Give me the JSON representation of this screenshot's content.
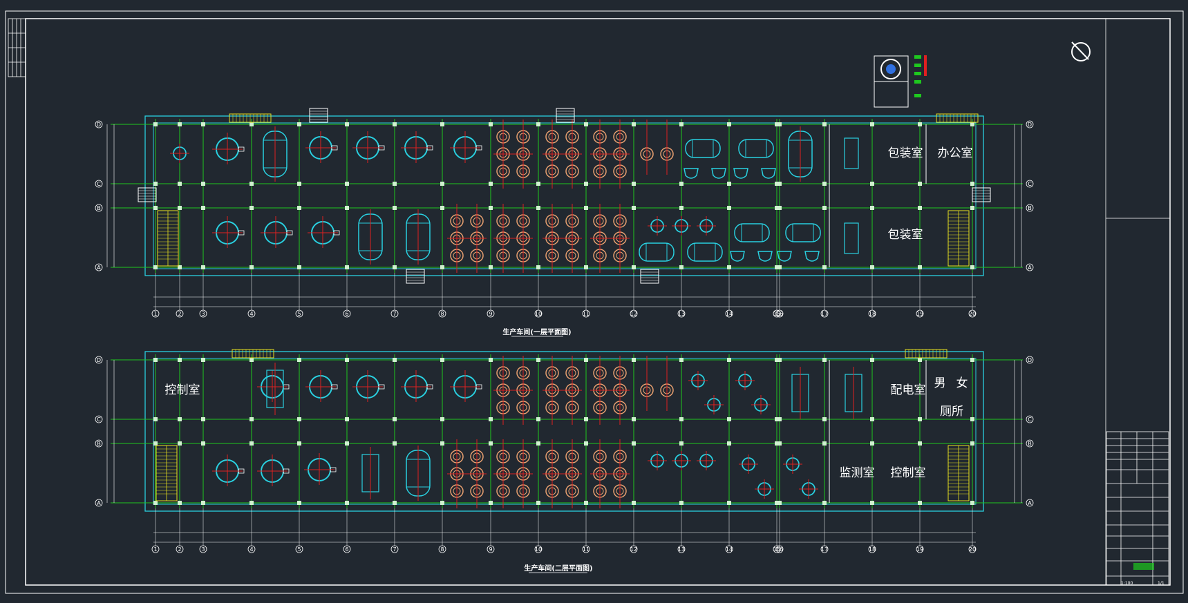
{
  "plan_titles": {
    "first_floor": "生产车间(一层平面图)",
    "second_floor": "生产车间(二层平面图)"
  },
  "axis_columns": [
    "1",
    "2",
    "3",
    "4",
    "5",
    "6",
    "7",
    "8",
    "9",
    "10",
    "11",
    "12",
    "13",
    "14",
    "15",
    "16",
    "17",
    "18",
    "19",
    "20"
  ],
  "axis_rows": [
    "D",
    "C",
    "B",
    "A"
  ],
  "first_floor_rooms": {
    "packing_room_1": "包装室",
    "office": "办公室",
    "packing_room_2": "包装室"
  },
  "second_floor_rooms": {
    "control_room_1": "控制室",
    "power_room": "配电室",
    "male": "男",
    "female": "女",
    "toilet": "厕所",
    "monitoring_room": "监测室",
    "control_room_2": "控制室"
  },
  "title_block": {
    "scale": "1:100",
    "sheet": "1/1"
  },
  "colors": {
    "background": "#212830",
    "frame": "#ffffff",
    "grid": "#1ec81e",
    "walls": "#29d0e0",
    "equipment_center": "#e02020",
    "tank_ring": "#e8a070",
    "stairs": "#e8e020"
  }
}
